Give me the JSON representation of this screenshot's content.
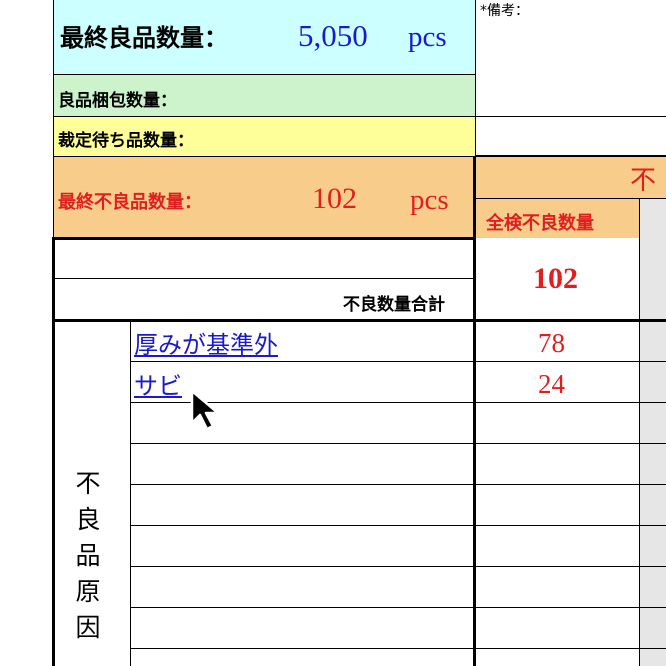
{
  "summary": {
    "final_good_label": "最終良品数量：",
    "final_good_value": "5,050",
    "final_good_unit": "pcs",
    "good_pack_label": "良品梱包数量：",
    "cutting_pending_label": "裁定待ち品数量：",
    "final_defect_label": "最終不良品数量：",
    "final_defect_value": "102",
    "final_defect_unit": "pcs"
  },
  "remarks_label": "*備考：",
  "defect_header": {
    "partial_title": "不",
    "inspection_col": "全検不良数量"
  },
  "total": {
    "label": "不良数量合計",
    "value": "102"
  },
  "cause_column_label": [
    "不",
    "良",
    "品",
    "原",
    "因"
  ],
  "causes": [
    {
      "name": "厚みが基準外",
      "qty": "78"
    },
    {
      "name": "サビ",
      "qty": "24"
    }
  ],
  "colors": {
    "cyan": "#ccffff",
    "green": "#cdf3cd",
    "yellow": "#ffff99",
    "orange": "#f8cc8a",
    "gray": "#e6e6e6",
    "red": "#e02020",
    "blue": "#1a1acc"
  }
}
